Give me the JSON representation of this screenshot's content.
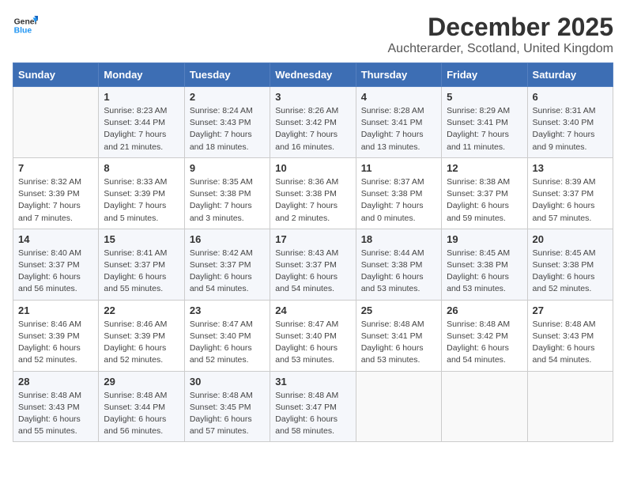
{
  "header": {
    "logo_general": "General",
    "logo_blue": "Blue",
    "month": "December 2025",
    "location": "Auchterarder, Scotland, United Kingdom"
  },
  "days_of_week": [
    "Sunday",
    "Monday",
    "Tuesday",
    "Wednesday",
    "Thursday",
    "Friday",
    "Saturday"
  ],
  "weeks": [
    [
      {
        "day": "",
        "content": ""
      },
      {
        "day": "1",
        "content": "Sunrise: 8:23 AM\nSunset: 3:44 PM\nDaylight: 7 hours\nand 21 minutes."
      },
      {
        "day": "2",
        "content": "Sunrise: 8:24 AM\nSunset: 3:43 PM\nDaylight: 7 hours\nand 18 minutes."
      },
      {
        "day": "3",
        "content": "Sunrise: 8:26 AM\nSunset: 3:42 PM\nDaylight: 7 hours\nand 16 minutes."
      },
      {
        "day": "4",
        "content": "Sunrise: 8:28 AM\nSunset: 3:41 PM\nDaylight: 7 hours\nand 13 minutes."
      },
      {
        "day": "5",
        "content": "Sunrise: 8:29 AM\nSunset: 3:41 PM\nDaylight: 7 hours\nand 11 minutes."
      },
      {
        "day": "6",
        "content": "Sunrise: 8:31 AM\nSunset: 3:40 PM\nDaylight: 7 hours\nand 9 minutes."
      }
    ],
    [
      {
        "day": "7",
        "content": "Sunrise: 8:32 AM\nSunset: 3:39 PM\nDaylight: 7 hours\nand 7 minutes."
      },
      {
        "day": "8",
        "content": "Sunrise: 8:33 AM\nSunset: 3:39 PM\nDaylight: 7 hours\nand 5 minutes."
      },
      {
        "day": "9",
        "content": "Sunrise: 8:35 AM\nSunset: 3:38 PM\nDaylight: 7 hours\nand 3 minutes."
      },
      {
        "day": "10",
        "content": "Sunrise: 8:36 AM\nSunset: 3:38 PM\nDaylight: 7 hours\nand 2 minutes."
      },
      {
        "day": "11",
        "content": "Sunrise: 8:37 AM\nSunset: 3:38 PM\nDaylight: 7 hours\nand 0 minutes."
      },
      {
        "day": "12",
        "content": "Sunrise: 8:38 AM\nSunset: 3:37 PM\nDaylight: 6 hours\nand 59 minutes."
      },
      {
        "day": "13",
        "content": "Sunrise: 8:39 AM\nSunset: 3:37 PM\nDaylight: 6 hours\nand 57 minutes."
      }
    ],
    [
      {
        "day": "14",
        "content": "Sunrise: 8:40 AM\nSunset: 3:37 PM\nDaylight: 6 hours\nand 56 minutes."
      },
      {
        "day": "15",
        "content": "Sunrise: 8:41 AM\nSunset: 3:37 PM\nDaylight: 6 hours\nand 55 minutes."
      },
      {
        "day": "16",
        "content": "Sunrise: 8:42 AM\nSunset: 3:37 PM\nDaylight: 6 hours\nand 54 minutes."
      },
      {
        "day": "17",
        "content": "Sunrise: 8:43 AM\nSunset: 3:37 PM\nDaylight: 6 hours\nand 54 minutes."
      },
      {
        "day": "18",
        "content": "Sunrise: 8:44 AM\nSunset: 3:38 PM\nDaylight: 6 hours\nand 53 minutes."
      },
      {
        "day": "19",
        "content": "Sunrise: 8:45 AM\nSunset: 3:38 PM\nDaylight: 6 hours\nand 53 minutes."
      },
      {
        "day": "20",
        "content": "Sunrise: 8:45 AM\nSunset: 3:38 PM\nDaylight: 6 hours\nand 52 minutes."
      }
    ],
    [
      {
        "day": "21",
        "content": "Sunrise: 8:46 AM\nSunset: 3:39 PM\nDaylight: 6 hours\nand 52 minutes."
      },
      {
        "day": "22",
        "content": "Sunrise: 8:46 AM\nSunset: 3:39 PM\nDaylight: 6 hours\nand 52 minutes."
      },
      {
        "day": "23",
        "content": "Sunrise: 8:47 AM\nSunset: 3:40 PM\nDaylight: 6 hours\nand 52 minutes."
      },
      {
        "day": "24",
        "content": "Sunrise: 8:47 AM\nSunset: 3:40 PM\nDaylight: 6 hours\nand 53 minutes."
      },
      {
        "day": "25",
        "content": "Sunrise: 8:48 AM\nSunset: 3:41 PM\nDaylight: 6 hours\nand 53 minutes."
      },
      {
        "day": "26",
        "content": "Sunrise: 8:48 AM\nSunset: 3:42 PM\nDaylight: 6 hours\nand 54 minutes."
      },
      {
        "day": "27",
        "content": "Sunrise: 8:48 AM\nSunset: 3:43 PM\nDaylight: 6 hours\nand 54 minutes."
      }
    ],
    [
      {
        "day": "28",
        "content": "Sunrise: 8:48 AM\nSunset: 3:43 PM\nDaylight: 6 hours\nand 55 minutes."
      },
      {
        "day": "29",
        "content": "Sunrise: 8:48 AM\nSunset: 3:44 PM\nDaylight: 6 hours\nand 56 minutes."
      },
      {
        "day": "30",
        "content": "Sunrise: 8:48 AM\nSunset: 3:45 PM\nDaylight: 6 hours\nand 57 minutes."
      },
      {
        "day": "31",
        "content": "Sunrise: 8:48 AM\nSunset: 3:47 PM\nDaylight: 6 hours\nand 58 minutes."
      },
      {
        "day": "",
        "content": ""
      },
      {
        "day": "",
        "content": ""
      },
      {
        "day": "",
        "content": ""
      }
    ]
  ]
}
